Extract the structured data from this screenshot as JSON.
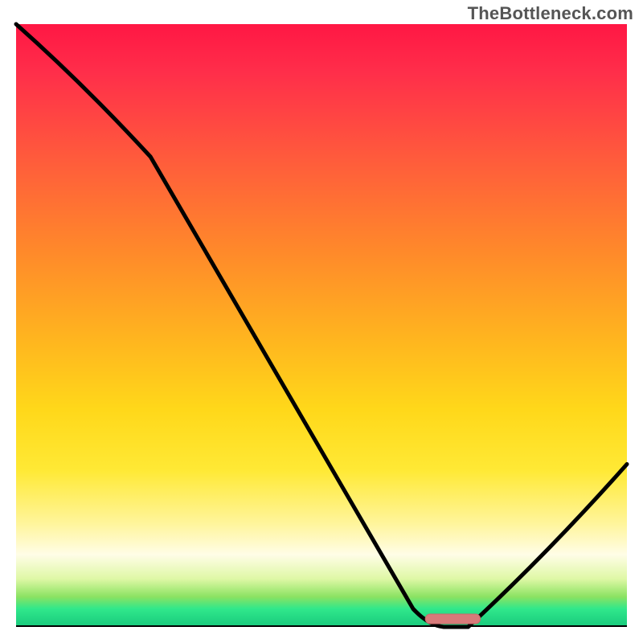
{
  "watermark": "TheBottleneck.com",
  "chart_data": {
    "type": "line",
    "title": "",
    "xlabel": "",
    "ylabel": "",
    "xlim": [
      0,
      100
    ],
    "ylim": [
      0,
      100
    ],
    "x": [
      0,
      22,
      65,
      70,
      74,
      100
    ],
    "values": [
      100,
      78,
      3,
      0,
      0,
      27
    ],
    "minimum_marker": {
      "x_start": 67,
      "x_end": 76,
      "y": 0.5
    },
    "gradient_stops": [
      {
        "pos": 0.0,
        "color": "#ff1744"
      },
      {
        "pos": 0.08,
        "color": "#ff2e4a"
      },
      {
        "pos": 0.22,
        "color": "#ff5a3c"
      },
      {
        "pos": 0.38,
        "color": "#ff8a2a"
      },
      {
        "pos": 0.52,
        "color": "#ffb41f"
      },
      {
        "pos": 0.64,
        "color": "#ffd81a"
      },
      {
        "pos": 0.74,
        "color": "#ffe935"
      },
      {
        "pos": 0.83,
        "color": "#fff59d"
      },
      {
        "pos": 0.88,
        "color": "#fffde7"
      },
      {
        "pos": 0.92,
        "color": "#dff8a6"
      },
      {
        "pos": 0.95,
        "color": "#8be262"
      },
      {
        "pos": 0.97,
        "color": "#30e88b"
      },
      {
        "pos": 1.0,
        "color": "#18c97c"
      }
    ]
  },
  "colors": {
    "curve": "#000000",
    "marker_fill": "#d87a7a",
    "marker_stroke": "#c96a6a",
    "baseline": "#000000"
  }
}
